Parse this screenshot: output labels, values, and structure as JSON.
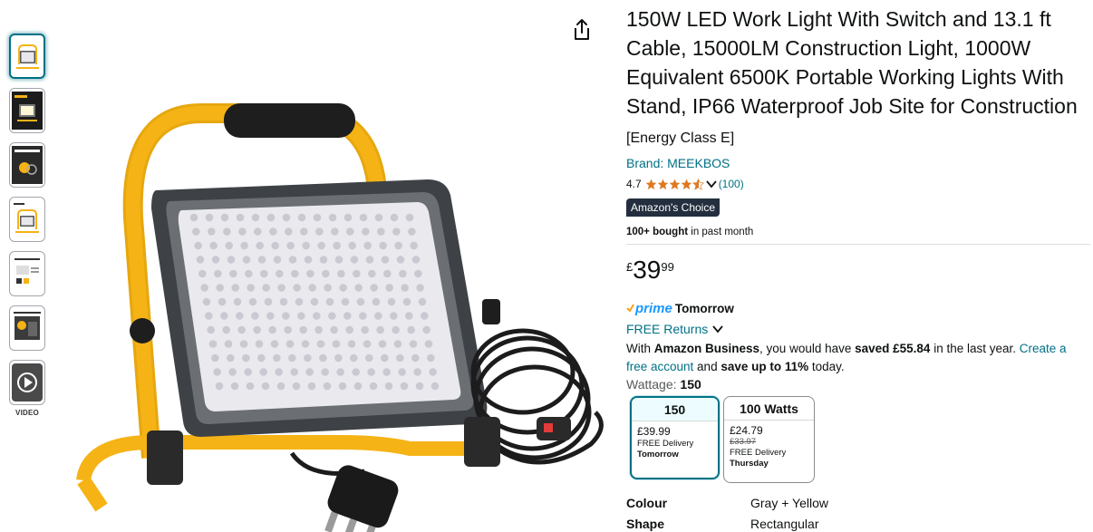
{
  "thumbnails": [
    {
      "name": "thumb-1",
      "active": true
    },
    {
      "name": "thumb-2",
      "active": false
    },
    {
      "name": "thumb-3",
      "active": false
    },
    {
      "name": "thumb-4",
      "active": false
    },
    {
      "name": "thumb-5",
      "active": false
    },
    {
      "name": "thumb-6",
      "active": false
    }
  ],
  "video_label": "VIDEO",
  "product": {
    "title": "150W LED Work Light With Switch and 13.1 ft Cable, 15000LM Construction Light, 1000W Equivalent 6500K Portable Working Lights With Stand, IP66 Waterproof Job Site for Construction",
    "energy_class": "[Energy Class E]",
    "brand": "Brand: MEEKBOS",
    "rating": "4.7",
    "rating_stars": 4.5,
    "rating_count": "(100)",
    "badge": "Amazon's Choice",
    "bought_bold": "100+ bought",
    "bought_rest": " in past month",
    "price_symbol": "£",
    "price_whole": "39",
    "price_fraction": "99"
  },
  "delivery": {
    "prime_label": "prime",
    "prime_when": "Tomorrow",
    "returns": "FREE Returns"
  },
  "business": {
    "t1": "With ",
    "b1": "Amazon Business",
    "t2": ", you would have ",
    "b2": "saved £55.84",
    "t3": " in the last year. ",
    "link": "Create a free account",
    "t4": " and ",
    "b3": "save up to 11%",
    "t5": " today."
  },
  "wattage": {
    "label": "Wattage: ",
    "value": "150"
  },
  "options": [
    {
      "label": "150",
      "price": "£39.99",
      "strike": "",
      "delivery": "FREE Delivery",
      "day": "Tomorrow",
      "selected": true
    },
    {
      "label": "100 Watts",
      "price": "£24.79",
      "strike": "£33.97",
      "delivery": "FREE Delivery",
      "day": "Thursday",
      "selected": false
    }
  ],
  "attributes": [
    {
      "key": "Colour",
      "value": "Gray + Yellow"
    },
    {
      "key": "Shape",
      "value": "Rectangular"
    }
  ],
  "colors": {
    "link": "#007185",
    "star": "#de7921",
    "badge_bg": "#232f3e",
    "prime": "#1a98ff",
    "frame_yellow": "#f5b316"
  },
  "icons": {
    "share": "share-icon",
    "chevron": "chevron-down-icon",
    "play": "play-icon",
    "star": "star-icon"
  }
}
